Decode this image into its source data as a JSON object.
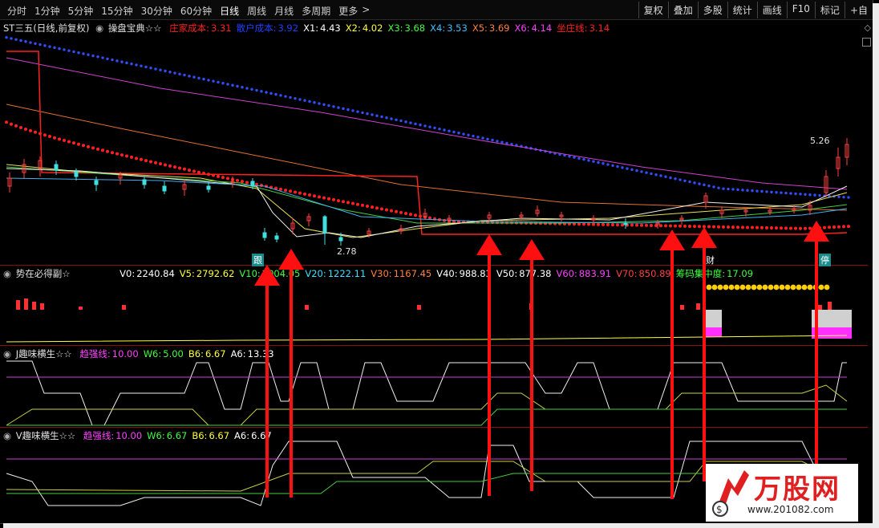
{
  "toolbar": {
    "periods": [
      "分时",
      "1分钟",
      "5分钟",
      "15分钟",
      "30分钟",
      "60分钟",
      "日线",
      "周线",
      "月线",
      "多周期",
      "更多"
    ],
    "active_period": "日线",
    "right_buttons": [
      "复权",
      "叠加",
      "多股",
      "统计",
      "画线",
      "F10",
      "标记",
      "+自"
    ]
  },
  "main_panel": {
    "title": "ST三五(日线,前复权)",
    "indicator_name": "操盘宝典☆☆",
    "values": [
      {
        "label": "庄家成本:",
        "value": "3.31",
        "color": "#ff2020"
      },
      {
        "label": "散户成本:",
        "value": "3.92",
        "color": "#2040ff"
      },
      {
        "label": "X1:",
        "value": "4.43",
        "color": "#ffffff"
      },
      {
        "label": "X2:",
        "value": "4.02",
        "color": "#ffff40"
      },
      {
        "label": "X3:",
        "value": "3.68",
        "color": "#40ff40"
      },
      {
        "label": "X4:",
        "value": "3.53",
        "color": "#40c0ff"
      },
      {
        "label": "X5:",
        "value": "3.69",
        "color": "#ff8040"
      },
      {
        "label": "X6:",
        "value": "4.14",
        "color": "#ff40ff"
      },
      {
        "label": "坐庄线:",
        "value": "3.14",
        "color": "#ff2020"
      }
    ],
    "high_label": "5.26",
    "low_label": "2.78",
    "markers": [
      "跟",
      "财",
      "停"
    ]
  },
  "volume_panel": {
    "title": "势在必得副☆",
    "values": [
      {
        "label": "V0:",
        "value": "2240.84",
        "color": "#ffffff"
      },
      {
        "label": "V5:",
        "value": "2792.62",
        "color": "#ffff40"
      },
      {
        "label": "V10:",
        "value": "2004.05",
        "color": "#40ff40"
      },
      {
        "label": "V20:",
        "value": "1222.11",
        "color": "#40e0ff"
      },
      {
        "label": "V30:",
        "value": "1167.45",
        "color": "#ff8040"
      },
      {
        "label": "V40:",
        "value": "988.83",
        "color": "#ffffff"
      },
      {
        "label": "V50:",
        "value": "877.38",
        "color": "#ffffff"
      },
      {
        "label": "V60:",
        "value": "883.91",
        "color": "#ff40ff"
      },
      {
        "label": "V70:",
        "value": "850.89",
        "color": "#ff4040"
      },
      {
        "label": "筹码集中度:",
        "value": "17.09",
        "color": "#40ff40"
      }
    ]
  },
  "j_panel": {
    "title": "J趣味横生☆☆",
    "values": [
      {
        "label": "趋强线:",
        "value": "10.00",
        "color": "#ff40ff"
      },
      {
        "label": "W6:",
        "value": "5.00",
        "color": "#40ff40"
      },
      {
        "label": "B6:",
        "value": "6.67",
        "color": "#ffff40"
      },
      {
        "label": "A6:",
        "value": "13.33",
        "color": "#ffffff"
      }
    ]
  },
  "v_panel": {
    "title": "V趣味横生☆☆",
    "values": [
      {
        "label": "趋强线:",
        "value": "10.00",
        "color": "#ff40ff"
      },
      {
        "label": "W6:",
        "value": "6.67",
        "color": "#40ff40"
      },
      {
        "label": "B6:",
        "value": "6.67",
        "color": "#ffff40"
      },
      {
        "label": "A6:",
        "value": "6.67",
        "color": "#ffffff"
      }
    ]
  },
  "watermark": {
    "title": "万股网",
    "url": "www.201082.com"
  }
}
